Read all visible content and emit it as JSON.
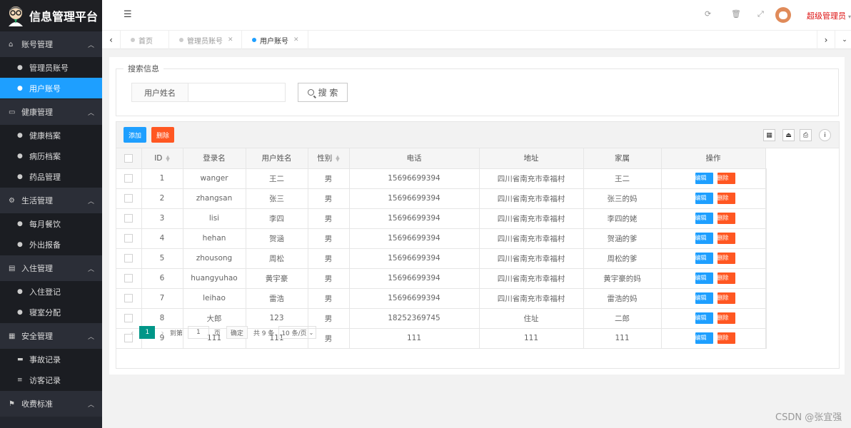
{
  "app": {
    "title": "信息管理平台"
  },
  "sidebar": {
    "groups": [
      {
        "label": "账号管理",
        "icon": "home-icon",
        "items": [
          {
            "label": "管理员账号",
            "icon": "user-icon"
          },
          {
            "label": "用户账号",
            "icon": "user-icon",
            "active": true
          }
        ]
      },
      {
        "label": "健康管理",
        "icon": "card-icon",
        "items": [
          {
            "label": "健康档案",
            "icon": "user-icon"
          },
          {
            "label": "病历档案",
            "icon": "user-icon"
          },
          {
            "label": "药品管理",
            "icon": "user-icon"
          }
        ]
      },
      {
        "label": "生活管理",
        "icon": "gears-icon",
        "items": [
          {
            "label": "每月餐饮",
            "icon": "user-icon"
          },
          {
            "label": "外出报备",
            "icon": "user-icon"
          }
        ]
      },
      {
        "label": "入住管理",
        "icon": "file-icon",
        "items": [
          {
            "label": "入住登记",
            "icon": "user-icon"
          },
          {
            "label": "寝室分配",
            "icon": "user-icon"
          }
        ]
      },
      {
        "label": "安全管理",
        "icon": "calendar-icon",
        "items": [
          {
            "label": "事故记录",
            "icon": "list-icon"
          },
          {
            "label": "访客记录",
            "icon": "menu-icon"
          }
        ]
      },
      {
        "label": "收费标准",
        "icon": "flag-icon",
        "items": []
      }
    ]
  },
  "header": {
    "user_name": "超级管理员",
    "caret": "▾"
  },
  "tabs": [
    {
      "label": "首页"
    },
    {
      "label": "管理员账号"
    },
    {
      "label": "用户账号",
      "active": true
    }
  ],
  "search": {
    "legend": "搜索信息",
    "field_label": "用户姓名",
    "field_value": "",
    "button_label": "搜 索"
  },
  "toolbar": {
    "add_label": "添加",
    "delete_label": "删除"
  },
  "table": {
    "columns": [
      "ID",
      "登录名",
      "用户姓名",
      "性别",
      "电话",
      "地址",
      "家属",
      "操作"
    ],
    "edit_label": "编辑",
    "delete_label": "删除",
    "rows": [
      [
        "1",
        "wanger",
        "王二",
        "男",
        "15696699394",
        "四川省南充市幸福村",
        "王二"
      ],
      [
        "2",
        "zhangsan",
        "张三",
        "男",
        "15696699394",
        "四川省南充市幸福村",
        "张三的妈"
      ],
      [
        "3",
        "lisi",
        "李四",
        "男",
        "15696699394",
        "四川省南充市幸福村",
        "李四的姥"
      ],
      [
        "4",
        "hehan",
        "贺涵",
        "男",
        "15696699394",
        "四川省南充市幸福村",
        "贺涵的爹"
      ],
      [
        "5",
        "zhousong",
        "周松",
        "男",
        "15696699394",
        "四川省南充市幸福村",
        "周松的爹"
      ],
      [
        "6",
        "huangyuhao",
        "黄宇豪",
        "男",
        "15696699394",
        "四川省南充市幸福村",
        "黄宇豪的妈"
      ],
      [
        "7",
        "leihao",
        "雷浩",
        "男",
        "15696699394",
        "四川省南充市幸福村",
        "雷浩的妈"
      ],
      [
        "8",
        "大郎",
        "123",
        "男",
        "18252369745",
        "住址",
        "二郎"
      ],
      [
        "9",
        "111",
        "111",
        "男",
        "111",
        "111",
        "111"
      ]
    ]
  },
  "pager": {
    "current": "1",
    "goto_label": "到第",
    "goto_value": "1",
    "page_unit": "页",
    "confirm_label": "确定",
    "total_label": "共 9 条",
    "page_size": "10 条/页"
  },
  "watermark": "CSDN @张宜强"
}
